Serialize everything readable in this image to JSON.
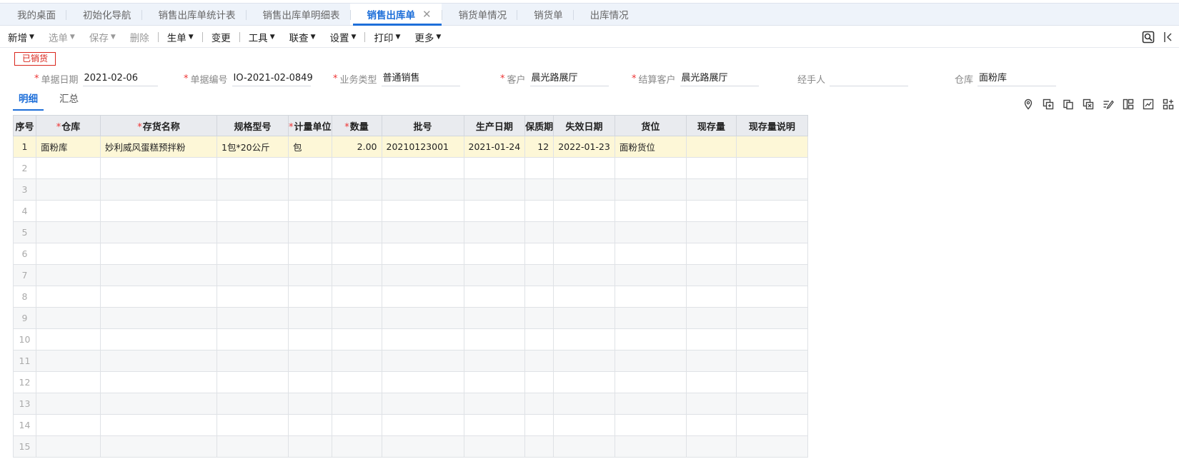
{
  "tabs": [
    {
      "label": "我的桌面"
    },
    {
      "label": "初始化导航"
    },
    {
      "label": "销售出库单统计表"
    },
    {
      "label": "销售出库单明细表"
    },
    {
      "label": "销售出库单",
      "active": true
    },
    {
      "label": "销货单情况"
    },
    {
      "label": "销货单"
    },
    {
      "label": "出库情况"
    }
  ],
  "toolbar": {
    "new": "新增",
    "select": "选单",
    "save": "保存",
    "delete": "删除",
    "generate": "生单",
    "change": "变更",
    "tools": "工具",
    "link_query": "联查",
    "settings": "设置",
    "print": "打印",
    "more": "更多"
  },
  "status_badge": "已销货",
  "form": {
    "doc_date": {
      "label": "单据日期",
      "value": "2021-02-06"
    },
    "doc_no": {
      "label": "单据编号",
      "value": "IO-2021-02-0849"
    },
    "biz_type": {
      "label": "业务类型",
      "value": "普通销售"
    },
    "customer": {
      "label": "客户",
      "value": "晨光路展厅"
    },
    "settle_customer": {
      "label": "结算客户",
      "value": "晨光路展厅"
    },
    "handler": {
      "label": "经手人",
      "value": ""
    },
    "warehouse": {
      "label": "仓库",
      "value": "面粉库"
    }
  },
  "subtabs": {
    "detail": "明细",
    "summary": "汇总"
  },
  "icons": [
    "location-icon",
    "add-row-icon",
    "copy-row-icon",
    "delete-row-icon",
    "edit-batch-icon",
    "layout-icon",
    "export-icon",
    "grid-settings-icon"
  ],
  "grid": {
    "headers": [
      "序号",
      "仓库",
      "存货名称",
      "规格型号",
      "计量单位",
      "数量",
      "批号",
      "生产日期",
      "保质期",
      "失效日期",
      "货位",
      "现存量",
      "现存量说明"
    ],
    "required": [
      false,
      true,
      true,
      false,
      true,
      true,
      false,
      false,
      false,
      false,
      false,
      false,
      false
    ],
    "rows": [
      [
        "1",
        "面粉库",
        "妙利威风蛋糕预拌粉",
        "1包*20公斤",
        "包",
        "2.00",
        "20210123001",
        "2021-01-24",
        "12",
        "2022-01-23",
        "面粉货位",
        "",
        ""
      ],
      [
        "2"
      ],
      [
        "3"
      ],
      [
        "4"
      ],
      [
        "5"
      ],
      [
        "6"
      ],
      [
        "7"
      ],
      [
        "8"
      ],
      [
        "9"
      ],
      [
        "10"
      ],
      [
        "11"
      ],
      [
        "12"
      ],
      [
        "13"
      ],
      [
        "14"
      ],
      [
        "15"
      ]
    ]
  },
  "colors": {
    "accent": "#1e6fd9",
    "required": "#e33333",
    "badge": "#d9261c",
    "selected_row": "#fdf7d7"
  }
}
